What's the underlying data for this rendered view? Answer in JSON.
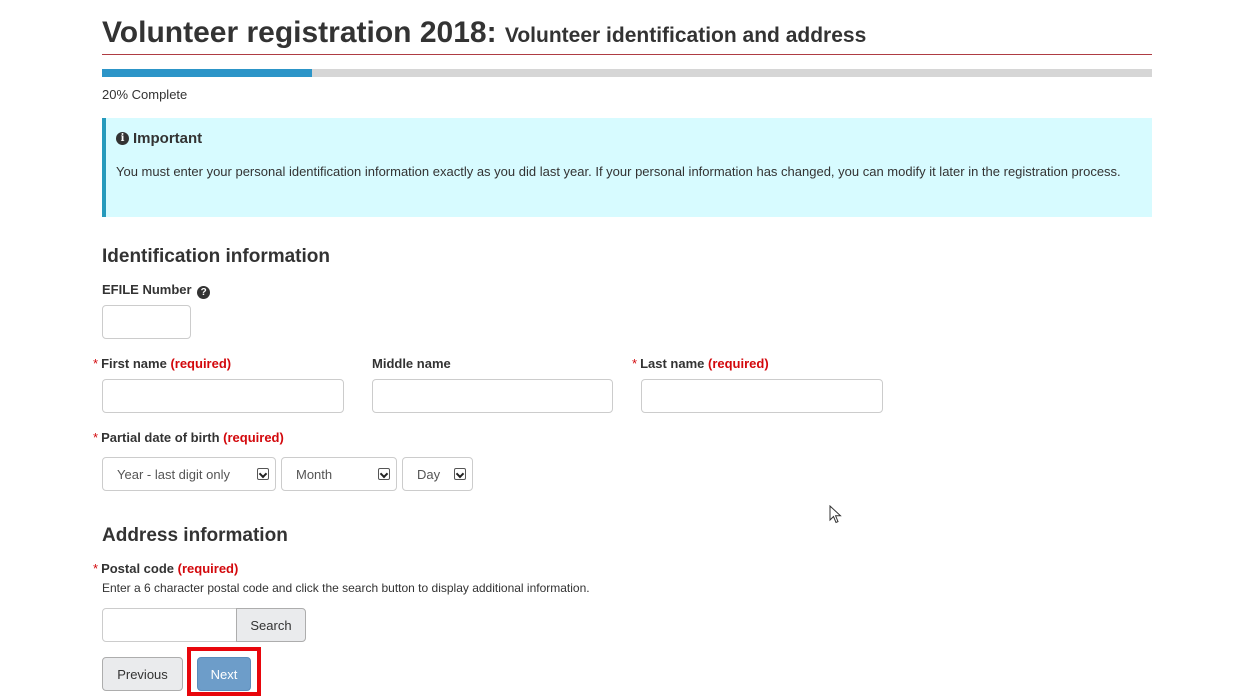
{
  "header": {
    "title": "Volunteer registration 2018:",
    "subtitle": "Volunteer identification and address"
  },
  "progress": {
    "percent": 20,
    "text": "20% Complete",
    "fill_color": "#2c95c8"
  },
  "alert": {
    "icon": "info-icon",
    "heading": "Important",
    "body": "You must enter your personal identification information exactly as you did last year. If your personal information has changed, you can modify it later in the registration process."
  },
  "identification": {
    "heading": "Identification information",
    "efile_label": "EFILE Number",
    "efile_value": "",
    "first_name_label": "First name",
    "middle_name_label": "Middle name",
    "last_name_label": "Last name",
    "required_text": "(required)",
    "required_marker": "*",
    "dob_label": "Partial date of birth",
    "dob_year": "Year - last digit only",
    "dob_month": "Month",
    "dob_day": "Day"
  },
  "address": {
    "heading": "Address information",
    "postal_label": "Postal code",
    "postal_help": "Enter a 6 character postal code and click the search button to display additional information.",
    "postal_value": "",
    "search_label": "Search"
  },
  "nav": {
    "previous_label": "Previous",
    "next_label": "Next"
  }
}
